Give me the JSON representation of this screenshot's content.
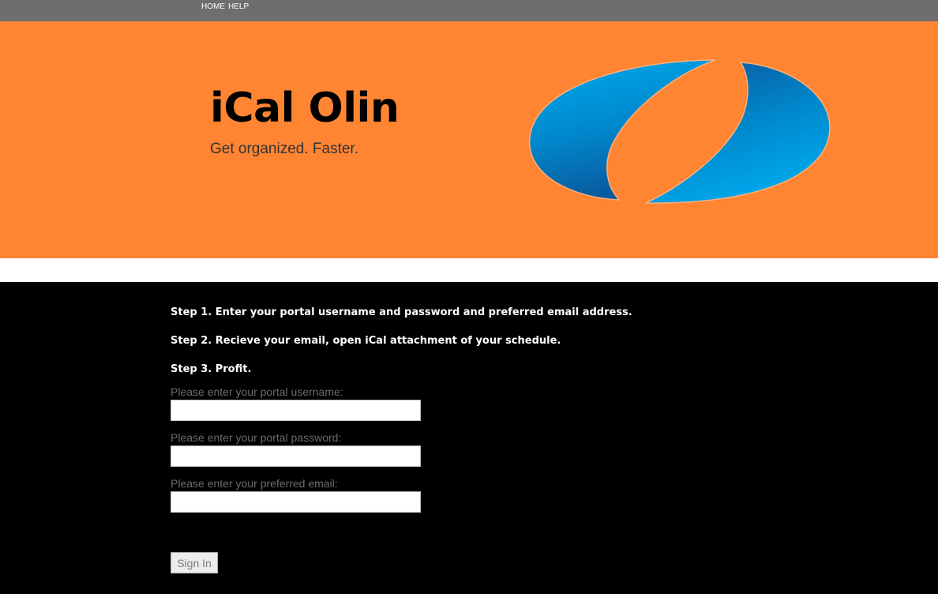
{
  "nav": {
    "home_label": "HOME",
    "help_label": "HELP"
  },
  "hero": {
    "title": "iCal Olin",
    "tagline": "Get organized. Faster.",
    "background_color": "#ff8533",
    "logo_icon": "blue-split-oval-logo-icon"
  },
  "steps": [
    "Step 1. Enter your portal username and password and preferred email address.",
    "Step 2. Recieve your email, open iCal attachment of your schedule.",
    "Step 3. Profit."
  ],
  "form": {
    "username_label": "Please enter your portal username:",
    "username_value": "",
    "password_label": "Please enter your portal password:",
    "password_value": "",
    "email_label": "Please enter your preferred email:",
    "email_value": "",
    "submit_label": "Sign In"
  },
  "colors": {
    "nav_bg": "#6e6e6e",
    "main_bg": "#000000",
    "logo_blue": "#0099dd"
  }
}
